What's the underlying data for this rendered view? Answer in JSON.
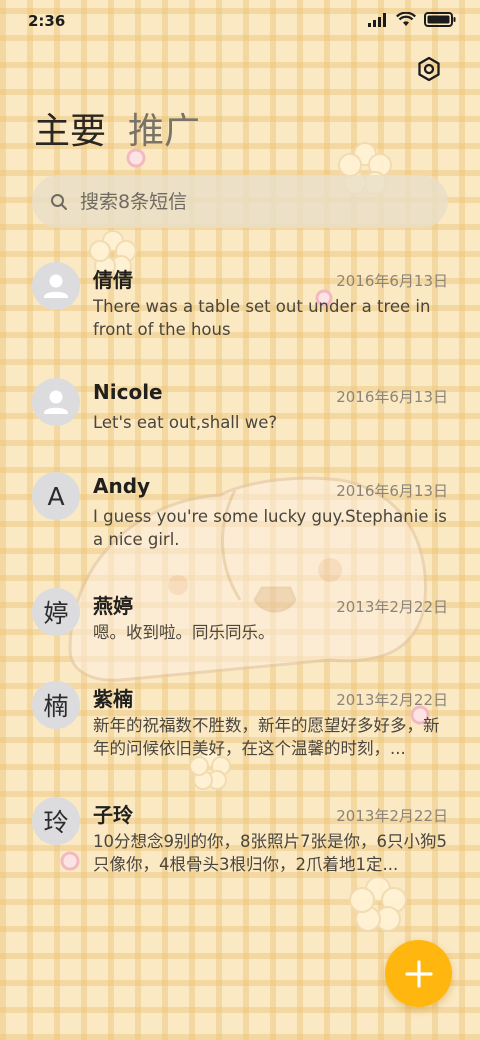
{
  "status_bar": {
    "time": "2:36",
    "icons": [
      "signal-icon",
      "wifi-icon",
      "battery-icon"
    ]
  },
  "header": {
    "settings_icon": "settings-icon",
    "tabs": [
      {
        "label": "主要",
        "active": true
      },
      {
        "label": "推广",
        "active": false
      }
    ]
  },
  "search": {
    "placeholder": "搜索8条短信",
    "icon": "search-icon"
  },
  "messages": [
    {
      "avatar": "person-icon",
      "name": "倩倩",
      "date": "2016年6月13日",
      "preview": "There was a table set out under a tree in front of the hous"
    },
    {
      "avatar": "person-icon",
      "name": "Nicole",
      "date": "2016年6月13日",
      "preview": "Let's eat out,shall we?"
    },
    {
      "avatar": "A",
      "name": "Andy",
      "date": "2016年6月13日",
      "preview": "I guess you're some lucky guy.Stephanie is a nice girl."
    },
    {
      "avatar": "婷",
      "name": "燕婷",
      "date": "2013年2月22日",
      "preview": "嗯。收到啦。同乐同乐。"
    },
    {
      "avatar": "楠",
      "name": "紫楠",
      "date": "2013年2月22日",
      "preview": "新年的祝福数不胜数，新年的愿望好多好多，新年的问候依旧美好，在这个温馨的时刻，..."
    },
    {
      "avatar": "玲",
      "name": "子玲",
      "date": "2013年2月22日",
      "preview": "10分想念9别的你，8张照片7张是你，6只小狗5只像你，4根骨头3根归你，2爪着地1定..."
    }
  ],
  "fab": {
    "icon": "plus-icon"
  },
  "colors": {
    "background": "#fbe9c3",
    "grid": "#ecc478",
    "accent": "#ffb70f",
    "avatar_bg": "#dcdcdf"
  }
}
